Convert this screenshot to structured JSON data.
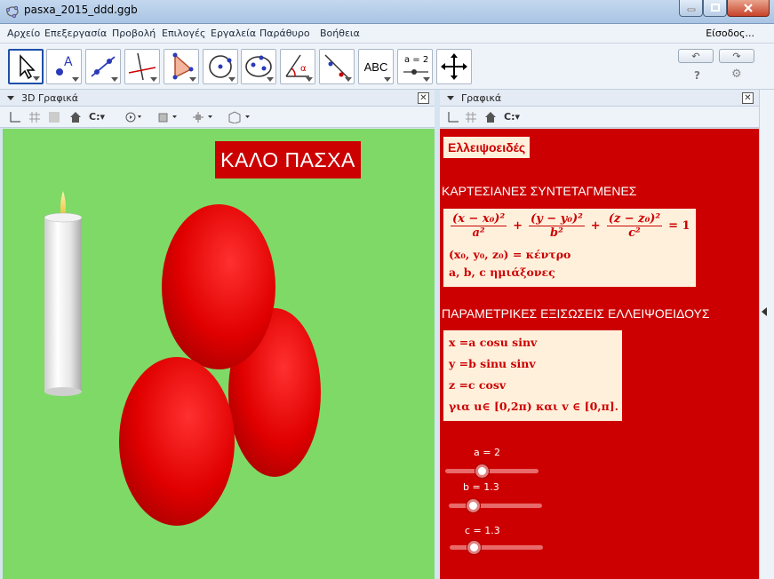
{
  "window": {
    "title": "pasxa_2015_ddd.ggb",
    "minimize_icon": "minimize-icon",
    "maximize_icon": "maximize-icon",
    "close_icon": "close-icon"
  },
  "menu": {
    "items": [
      "Αρχείο",
      "Επεξεργασία",
      "Προβολή",
      "Επιλογές",
      "Εργαλεία",
      "Παράθυρο",
      "Βοήθεια"
    ],
    "login": "Είσοδος..."
  },
  "toolbar": {
    "tools": [
      "move-tool-icon",
      "point-tool-icon",
      "line-tool-icon",
      "perpendicular-line-icon",
      "polygon-tool-icon",
      "circle-tool-icon",
      "conic-tool-icon",
      "angle-tool-icon",
      "reflect-tool-icon",
      "text-tool-icon",
      "slider-tool-icon",
      "move-view-icon"
    ],
    "text_tool_label": "ABC",
    "slider_tool_label": "a = 2",
    "help": "?",
    "settings_icon": "gear-icon"
  },
  "view3d": {
    "header": "3D Γραφικά",
    "banner": "ΚΑΛΟ ΠΑΣΧΑ",
    "background": "#7fd966",
    "egg_color": "#dd0000"
  },
  "graphics": {
    "header": "Γραφικά",
    "background": "#cc0000",
    "title": "Ελλειψοειδές",
    "heading_cartesian": "ΚΑΡΤΕΣΙΑΝΕΣ ΣΥΝΤΕΤΑΓΜΕΝΕΣ",
    "equation": {
      "t1_num": "(x − x₀)²",
      "t1_den": "a²",
      "t2_num": "(y − y₀)²",
      "t2_den": "b²",
      "t3_num": "(z − z₀)²",
      "t3_den": "c²",
      "plus": "+",
      "equals": "= 1"
    },
    "center_line": "(x₀, y₀, z₀) = κέντρο",
    "axes_line": "a, b, c ημιάξονες",
    "heading_parametric": "ΠΑΡΑΜΕΤΡΙΚΕΣ ΕΞΙΣΩΣΕΙΣ ΕΛΛΕΙΨΟΕΙΔΟΥΣ",
    "parametric": [
      "x =a cosu sinv",
      "y =b sinu sinv",
      "z =c cosv",
      "για  u∈ [0,2π) και  v ∈ [0,π]."
    ],
    "sliders": [
      {
        "label": "a = 2",
        "value": 2
      },
      {
        "label": "b = 1.3",
        "value": 1.3
      },
      {
        "label": "c = 1.3",
        "value": 1.3
      }
    ]
  }
}
